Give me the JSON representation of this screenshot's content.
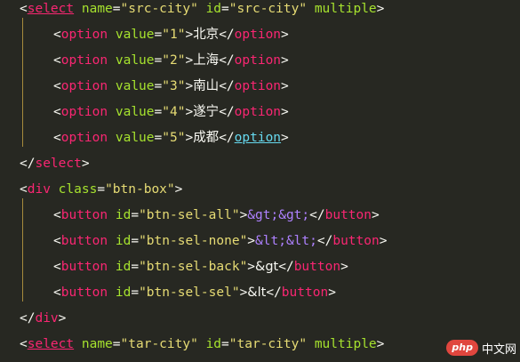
{
  "editor": {
    "lines": [
      {
        "tag": "select",
        "attrs": [
          {
            "name": "name",
            "value": "src-city"
          },
          {
            "name": "id",
            "value": "src-city"
          }
        ],
        "flag": "multiple"
      },
      {
        "tag": "option",
        "attr_name": "value",
        "attr_value": "1",
        "text": "北京",
        "close": "option"
      },
      {
        "tag": "option",
        "attr_name": "value",
        "attr_value": "2",
        "text": "上海",
        "close": "option"
      },
      {
        "tag": "option",
        "attr_name": "value",
        "attr_value": "3",
        "text": "南山",
        "close": "option"
      },
      {
        "tag": "option",
        "attr_name": "value",
        "attr_value": "4",
        "text": "遂宁",
        "close": "option"
      },
      {
        "tag": "option",
        "attr_name": "value",
        "attr_value": "5",
        "text": "成都",
        "close": "option"
      },
      {
        "close": "select"
      },
      {
        "tag": "div",
        "attr_name": "class",
        "attr_value": "btn-box"
      },
      {
        "tag": "button",
        "attr_name": "id",
        "attr_value": "btn-sel-all",
        "text": "&gt;&gt;",
        "close": "button"
      },
      {
        "tag": "button",
        "attr_name": "id",
        "attr_value": "btn-sel-none",
        "text": "&lt;&lt;",
        "close": "button"
      },
      {
        "tag": "button",
        "attr_name": "id",
        "attr_value": "btn-sel-back",
        "text": "&gt",
        "close": "button"
      },
      {
        "tag": "button",
        "attr_name": "id",
        "attr_value": "btn-sel-sel",
        "text": "&lt",
        "close": "button"
      },
      {
        "close": "div"
      },
      {
        "tag": "select",
        "attrs": [
          {
            "name": "name",
            "value": "tar-city"
          },
          {
            "name": "id",
            "value": "tar-city"
          }
        ],
        "flag": "multiple"
      }
    ]
  },
  "watermark": {
    "logo": "php",
    "text": "中文网"
  },
  "colors": {
    "background": "#272822",
    "tag": "#f92672",
    "attribute": "#a6e22e",
    "string": "#e6db74",
    "entity": "#ae81ff",
    "text": "#f8f8f2",
    "indent_guide": "#a68a3c"
  }
}
